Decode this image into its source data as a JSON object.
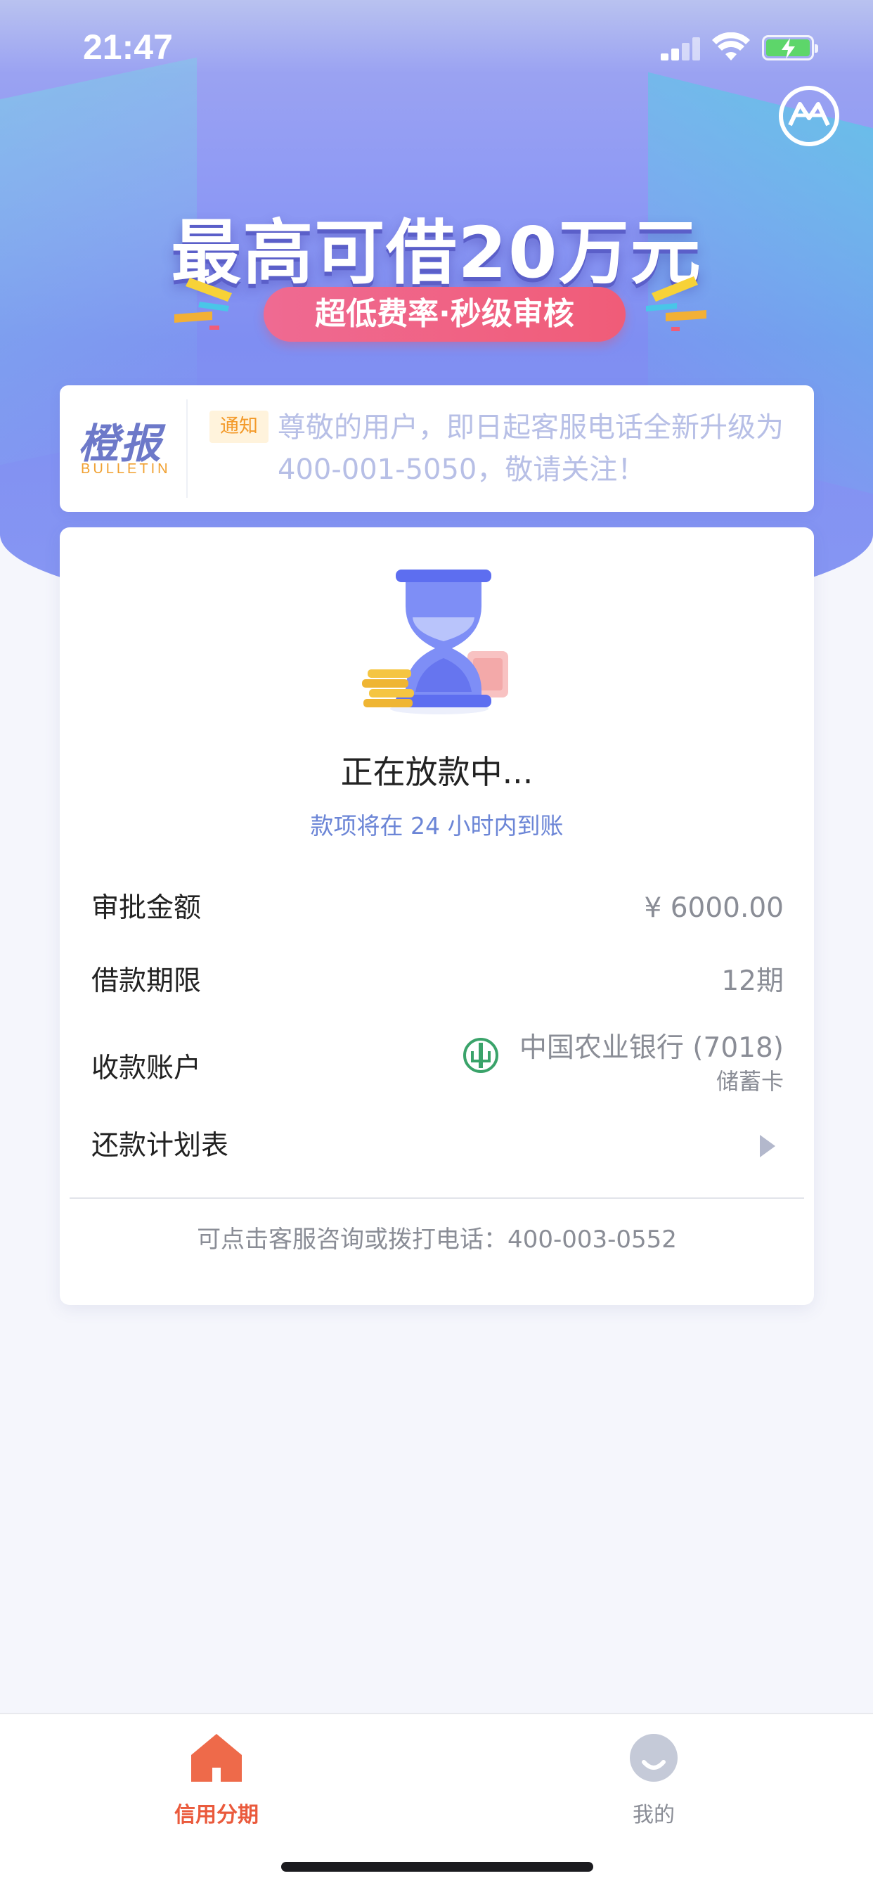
{
  "status_bar": {
    "time": "21:47"
  },
  "hero": {
    "title": "最高可借20万元",
    "pill": "超低费率·秒级审核"
  },
  "bulletin": {
    "logo_text": "橙报",
    "logo_sub": "BULLETIN",
    "tag": "通知",
    "message": "尊敬的用户，即日起客服电话全新升级为 400-001-5050，敬请关注！"
  },
  "loan_status": {
    "title": "正在放款中...",
    "subtitle": "款项将在 24 小时内到账",
    "details": {
      "amount_label": "审批金额",
      "amount_value": "¥ 6000.00",
      "term_label": "借款期限",
      "term_value": "12期",
      "account_label": "收款账户",
      "bank_name": "中国农业银行 (7018)",
      "card_type": "储蓄卡",
      "schedule_label": "还款计划表"
    },
    "footer": "可点击客服咨询或拨打电话：400-003-0552"
  },
  "tab_bar": {
    "tabs": [
      {
        "label": "信用分期",
        "icon": "home-icon",
        "active": true
      },
      {
        "label": "我的",
        "icon": "profile-icon",
        "active": false
      }
    ]
  },
  "colors": {
    "accent": "#ea5a3c",
    "hero_purple": "#8f9af4",
    "info_blue": "#6b85d6",
    "pill_pink": "#f05c78"
  }
}
